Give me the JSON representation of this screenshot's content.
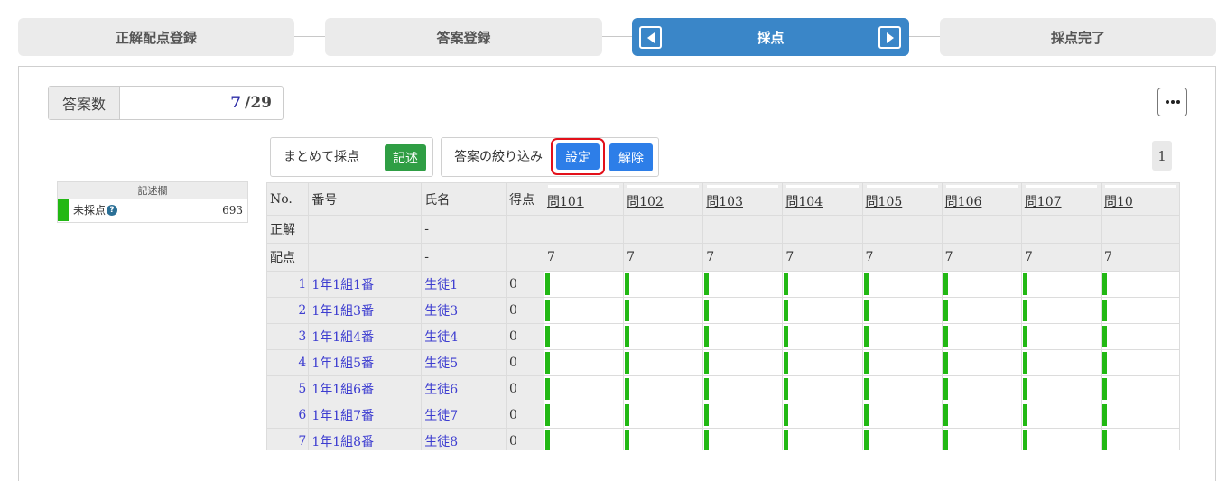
{
  "steps": [
    {
      "label": "正解配点登録",
      "active": false
    },
    {
      "label": "答案登録",
      "active": false
    },
    {
      "label": "採点",
      "active": true
    },
    {
      "label": "採点完了",
      "active": false
    }
  ],
  "answer_count": {
    "label": "答案数",
    "current": "7",
    "total": "/29"
  },
  "bulk": {
    "label": "まとめて採点",
    "button": "記述"
  },
  "filter": {
    "label": "答案の絞り込み",
    "set_button": "設定",
    "clear_button": "解除"
  },
  "pagination": {
    "page": "1"
  },
  "legend": {
    "header": "記述欄",
    "item_label": "未採点",
    "help": "?",
    "count": "693"
  },
  "colors": {
    "active_step": "#3a86c8",
    "green": "#2f9e44",
    "blue_button": "#2d7ee8",
    "highlight": "#e3101a",
    "ungraded_bar": "#22b814"
  },
  "grid": {
    "headers": {
      "no": "No.",
      "id": "番号",
      "name": "氏名",
      "score": "得点"
    },
    "questions": [
      "問101",
      "問102",
      "問103",
      "問104",
      "問105",
      "問106",
      "問107",
      "問10"
    ],
    "correct_row": {
      "label": "正解",
      "name": "-"
    },
    "points_row": {
      "label": "配点",
      "name": "-",
      "points": [
        "7",
        "7",
        "7",
        "7",
        "7",
        "7",
        "7",
        "7"
      ]
    },
    "students": [
      {
        "no": "1",
        "id": "1年1組1番",
        "name": "生徒1",
        "score": "0"
      },
      {
        "no": "2",
        "id": "1年1組3番",
        "name": "生徒3",
        "score": "0"
      },
      {
        "no": "3",
        "id": "1年1組4番",
        "name": "生徒4",
        "score": "0"
      },
      {
        "no": "4",
        "id": "1年1組5番",
        "name": "生徒5",
        "score": "0"
      },
      {
        "no": "5",
        "id": "1年1組6番",
        "name": "生徒6",
        "score": "0"
      },
      {
        "no": "6",
        "id": "1年1組7番",
        "name": "生徒7",
        "score": "0"
      },
      {
        "no": "7",
        "id": "1年1組8番",
        "name": "生徒8",
        "score": "0"
      }
    ]
  }
}
